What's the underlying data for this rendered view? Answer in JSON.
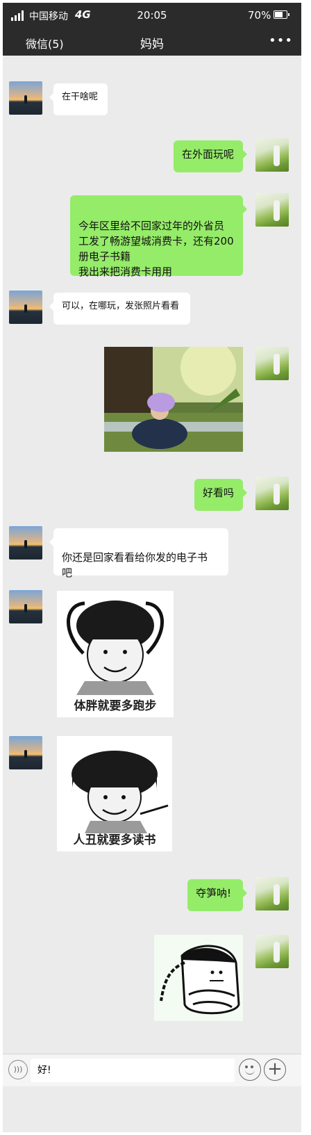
{
  "status": {
    "carrier": "中国移动",
    "network": "4G",
    "time": "20:05",
    "battery": "70%"
  },
  "header": {
    "back_label": "微信(5)",
    "title": "妈妈",
    "more_label": "•••"
  },
  "messages": [
    {
      "side": "in",
      "type": "text",
      "text": "在干啥呢"
    },
    {
      "side": "out",
      "type": "text",
      "text": "在外面玩呢"
    },
    {
      "side": "out",
      "type": "text",
      "text": "今年区里给不回家过年的外省员\n工发了畅游望城消费卡，还有200\n册电子书籍\n我出来把消费卡用用"
    },
    {
      "side": "in",
      "type": "text",
      "text": "可以，在哪玩，发张照片看看"
    },
    {
      "side": "out",
      "type": "image",
      "subject": "photo-girl-in-park"
    },
    {
      "side": "out",
      "type": "text",
      "text": "好看吗"
    },
    {
      "side": "in",
      "type": "text",
      "text": "你还是回家看看给你发的电子书\n吧"
    },
    {
      "side": "in",
      "type": "sticker",
      "caption": "体胖就要多跑步"
    },
    {
      "side": "in",
      "type": "sticker",
      "caption": "人丑就要多读书"
    },
    {
      "side": "out",
      "type": "text",
      "text": "夺笋呐!"
    },
    {
      "side": "out",
      "type": "sticker",
      "caption": ""
    }
  ],
  "input": {
    "value": "好!"
  },
  "icons": [
    "signal-icon",
    "battery-icon",
    "more-icon",
    "voice-icon",
    "emoji-icon",
    "plus-icon"
  ],
  "colors": {
    "bar": "#2b2b2b",
    "chat_bg": "#ebebeb",
    "outgoing": "#95ec69",
    "incoming": "#ffffff"
  }
}
